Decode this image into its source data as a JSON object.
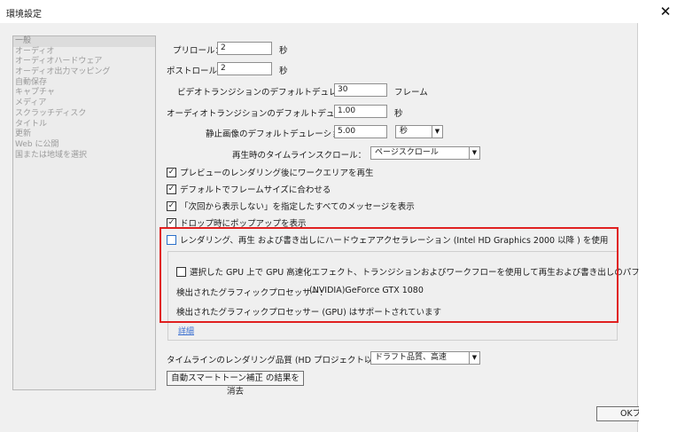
{
  "window": {
    "title": "環境設定"
  },
  "sidebar": {
    "items": [
      {
        "label": "一般"
      },
      {
        "label": "オーディオ"
      },
      {
        "label": "オーディオハードウェア"
      },
      {
        "label": "オーディオ出力マッピング"
      },
      {
        "label": "自動保存"
      },
      {
        "label": "キャプチャ"
      },
      {
        "label": "メディア"
      },
      {
        "label": "スクラッチディスク"
      },
      {
        "label": "タイトル"
      },
      {
        "label": "更新"
      },
      {
        "label": "Web に公開"
      },
      {
        "label": "国または地域を選択"
      }
    ]
  },
  "general": {
    "preroll_label": "プリロール：",
    "preroll_value": "2",
    "preroll_unit": "秒",
    "postroll_label": "ポストロール：",
    "postroll_value": "2",
    "postroll_unit": "秒",
    "video_transition_label": "ビデオトランジションのデフォルトデュレーション：",
    "video_transition_value": "30",
    "video_transition_unit": "フレーム",
    "audio_transition_label": "オーディオトランジションのデフォルトデュレーション：",
    "audio_transition_value": "1.00",
    "audio_transition_unit": "秒",
    "still_label": "静止画像のデフォルトデュレーション：",
    "still_value": "5.00",
    "still_unit_select": "秒",
    "timeline_scroll_label": "再生時のタイムラインスクロール：",
    "timeline_scroll_value": "ページスクロール",
    "checks": [
      {
        "label": "プレビューのレンダリング後にワークエリアを再生",
        "checked": "✓"
      },
      {
        "label": "デフォルトでフレームサイズに合わせる",
        "checked": "✓"
      },
      {
        "label": "「次回から表示しない」を指定したすべてのメッセージを表示",
        "checked": "✓"
      },
      {
        "label": "ドロップ時にポップアップを表示",
        "checked": "✓"
      }
    ],
    "hw_accel_label": "レンダリング、再生 および書き出しにハードウェアアクセラレーション (Intel HD Graphics 2000 以降 ) を使用",
    "gpu_check_label": "選択した GPU 上で GPU 高速化エフェクト、トランジションおよびワークフローを使用して再生および書き出しのパフォーマンスを向上",
    "detected_gpu_label": "検出されたグラフィックプロセッサー：",
    "detected_gpu_value": "(NVIDIA)GeForce GTX 1080",
    "gpu_supported_text": "検出されたグラフィックプロセッサー (GPU) はサポートされています",
    "details_link": "詳細",
    "render_quality_label": "タイムラインのレンダリング品質 (HD プロジェクト以上で有効)：",
    "render_quality_value": "ドラフト品質、高速",
    "smart_tone_button": "自動スマートトーン補正 の結果を消去",
    "ok_button": "OK",
    "ok_trailing": "ブ"
  },
  "colors": {
    "highlight_box": "#e02020",
    "link": "#3a6fd0"
  }
}
